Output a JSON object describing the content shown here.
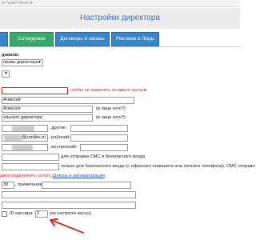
{
  "url_text": "n/?add=78ed=9",
  "page_title": "Настройки директора",
  "tabs": [
    {
      "label": ""
    },
    {
      "label": "Сотрудники"
    },
    {
      "label": "Договоры и заказы"
    },
    {
      "label": "Реклама и Лиды"
    }
  ],
  "section_heading": "дников:",
  "role_select": "права директора",
  "role_select2": "",
  "password_hint": "чтобы не изменять оставьте пустым",
  "name_field": "Алексей",
  "name_genitive_field": "Алексея",
  "name_genitive_hint": "(в лице кого?)",
  "position_field": "ального директора",
  "position_hint": "(в лице кого?)",
  "phone_other_label": ", другие:",
  "email_field": "@yandex.ru",
  "email_label": ", рабочий:",
  "internal_label": ", внутренний:",
  "sms_label": "для отправки СМС и безопасного входа",
  "safe_login_label": "только для безопасного входа (с офисного планшета или личного телефона), СМС отправл",
  "connect_text": "двео подключить услугу",
  "connect_link": "Шлюзы и автоматизация",
  "note_value": "30",
  "note_label": ", примечания:",
  "cashier_label": "ID кассира:",
  "cashier_value": "2",
  "cashier_hint": "(из настроек кассы)",
  "accent_color": "#3a84c9",
  "active_tab_color": "#3aa86b",
  "arrow_color": "#d42a2a"
}
